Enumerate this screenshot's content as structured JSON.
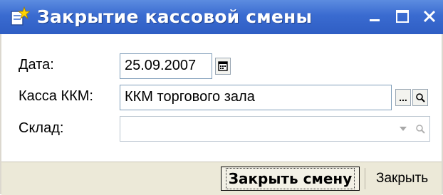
{
  "window": {
    "title": "Закрытие кассовой смены",
    "app_icon": "document-star-icon",
    "controls": {
      "minimize": "minimize-icon",
      "maximize": "maximize-icon",
      "close": "close-icon"
    }
  },
  "form": {
    "date_label": "Дата:",
    "date_value": "25.09.2007",
    "register_label": "Касса ККМ:",
    "register_value": "ККМ торгового зала",
    "register_select_glyph": "...",
    "warehouse_label": "Склад:",
    "warehouse_value": ""
  },
  "footer": {
    "close_shift_label": "Закрыть смену",
    "close_label": "Закрыть"
  },
  "colors": {
    "titlebar": "#3a6bd0",
    "footer_bg": "#ece9d8",
    "field_border": "#7f9db9"
  }
}
